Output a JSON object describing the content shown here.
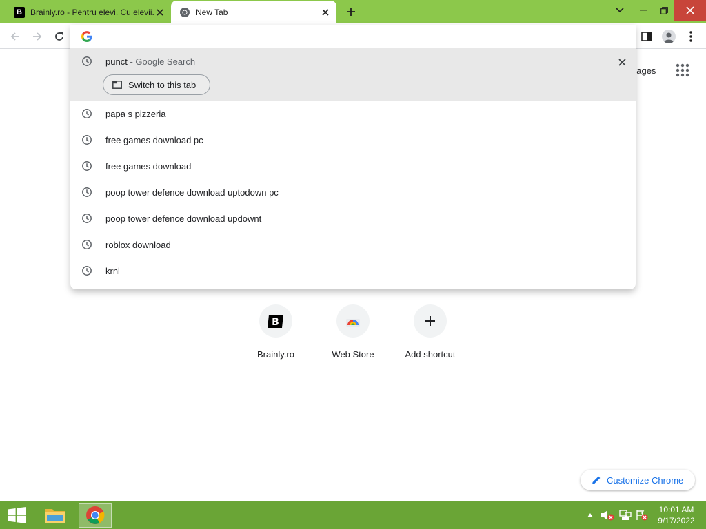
{
  "browser": {
    "tabs": [
      {
        "title": "Brainly.ro - Pentru elevi. Cu elevii.",
        "favicon": "brainly-icon",
        "active": false
      },
      {
        "title": "New Tab",
        "favicon": "chrome-icon",
        "active": true
      }
    ],
    "new_tab_icon": "plus-icon"
  },
  "omnibox": {
    "value": "",
    "selected_suggestion": {
      "query": "punct",
      "suffix": "- Google Search",
      "switch_label": "Switch to this tab"
    },
    "suggestions": [
      "papa s pizzeria",
      "free games download pc",
      "free games download",
      "poop tower defence download uptodown pc",
      "poop tower defence download updownt",
      "roblox download",
      "krnl"
    ]
  },
  "ntp": {
    "images_link": "nages",
    "shortcuts": [
      {
        "label": "Brainly.ro"
      },
      {
        "label": "Web Store"
      },
      {
        "label": "Add shortcut"
      }
    ],
    "customize_label": "Customize Chrome"
  },
  "taskbar": {
    "time": "10:01 AM",
    "date": "9/17/2022"
  },
  "colors": {
    "accent_green": "#8cc84b",
    "taskbar_green": "#6aa536",
    "link_blue": "#1a73e8"
  }
}
